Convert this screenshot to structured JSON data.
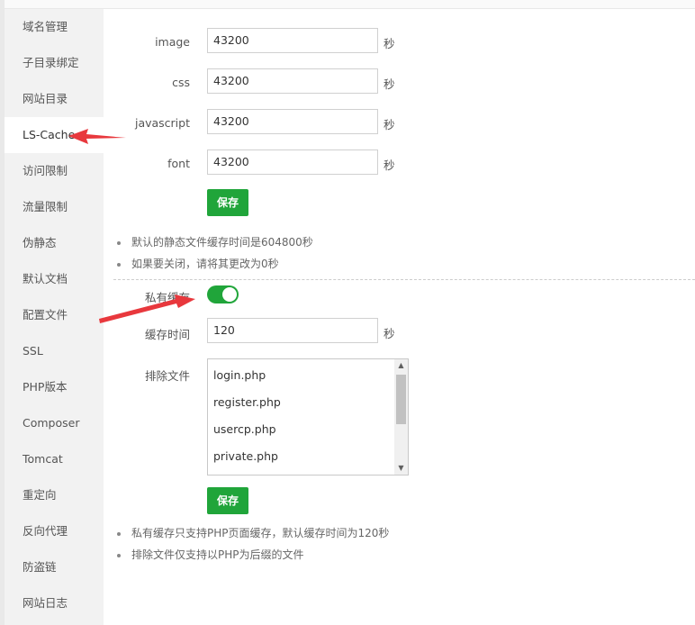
{
  "sidebar": {
    "items": [
      {
        "label": "域名管理"
      },
      {
        "label": "子目录绑定"
      },
      {
        "label": "网站目录"
      },
      {
        "label": "LS-Cache"
      },
      {
        "label": "访问限制"
      },
      {
        "label": "流量限制"
      },
      {
        "label": "伪静态"
      },
      {
        "label": "默认文档"
      },
      {
        "label": "配置文件"
      },
      {
        "label": "SSL"
      },
      {
        "label": "PHP版本"
      },
      {
        "label": "Composer"
      },
      {
        "label": "Tomcat"
      },
      {
        "label": "重定向"
      },
      {
        "label": "反向代理"
      },
      {
        "label": "防盗链"
      },
      {
        "label": "网站日志"
      }
    ],
    "active": "LS-Cache"
  },
  "static_cache": {
    "fields": [
      {
        "label": "image",
        "value": "43200",
        "unit": "秒"
      },
      {
        "label": "css",
        "value": "43200",
        "unit": "秒"
      },
      {
        "label": "javascript",
        "value": "43200",
        "unit": "秒"
      },
      {
        "label": "font",
        "value": "43200",
        "unit": "秒"
      }
    ],
    "save_label": "保存",
    "notes": [
      "默认的静态文件缓存时间是604800秒",
      "如果要关闭，请将其更改为0秒"
    ]
  },
  "private_cache": {
    "toggle_label": "私有缓存",
    "enabled": true,
    "time_label": "缓存时间",
    "time_value": "120",
    "time_unit": "秒",
    "exclude_label": "排除文件",
    "exclude_files": [
      "login.php",
      "register.php",
      "usercp.php",
      "private.php"
    ],
    "save_label": "保存",
    "notes": [
      "私有缓存只支持PHP页面缓存，默认缓存时间为120秒",
      "排除文件仅支持以PHP为后缀的文件"
    ]
  },
  "colors": {
    "accent": "#20a53a",
    "annotation_arrow": "#e8383d"
  }
}
